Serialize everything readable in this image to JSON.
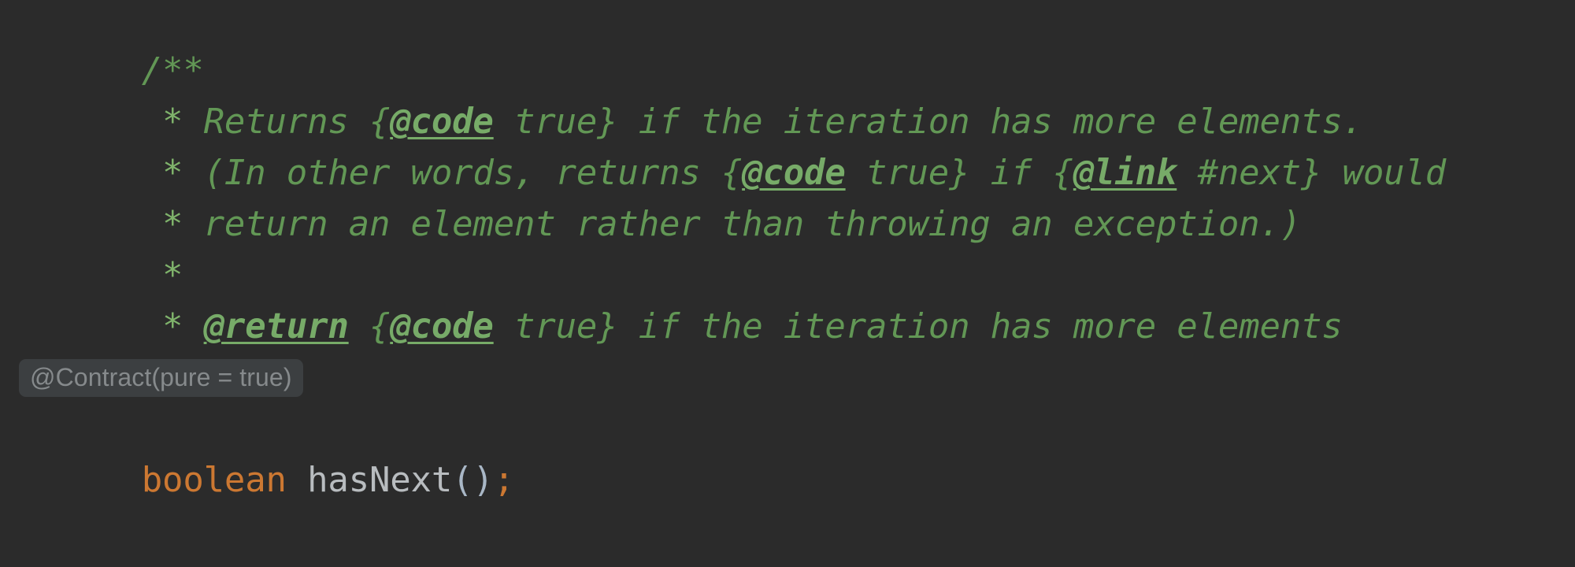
{
  "editor": {
    "theme": "Darcula",
    "language": "Java",
    "background_color": "#2b2b2b",
    "comment_color": "#629755",
    "tag_color": "#77ab68",
    "keyword_color": "#cc7832",
    "identifier_color": "#b8bcbf",
    "inlay_bg_color": "#3c3f41",
    "inlay_text_color": "#868a8c"
  },
  "javadoc": {
    "open": "/**",
    "close": " */",
    "lines": [
      {
        "star": " * ",
        "parts": [
          {
            "t": "Returns {",
            "tag": false
          },
          {
            "t": "@code",
            "tag": true
          },
          {
            "t": " true} if the iteration has more elements.",
            "tag": false
          }
        ]
      },
      {
        "star": " * ",
        "parts": [
          {
            "t": "(In other words, returns {",
            "tag": false
          },
          {
            "t": "@code",
            "tag": true
          },
          {
            "t": " true} if {",
            "tag": false
          },
          {
            "t": "@link",
            "tag": true
          },
          {
            "t": " #next} would",
            "tag": false
          }
        ]
      },
      {
        "star": " * ",
        "parts": [
          {
            "t": "return an element rather than throwing an exception.)",
            "tag": false
          }
        ]
      },
      {
        "star": " *",
        "parts": []
      },
      {
        "star": " * ",
        "parts": [
          {
            "t": "@return",
            "tag": true
          },
          {
            "t": " {",
            "tag": false
          },
          {
            "t": "@code",
            "tag": true
          },
          {
            "t": " true} if the iteration has more elements",
            "tag": false
          }
        ]
      }
    ]
  },
  "inlay": {
    "annotation_hint": "@Contract(pure = true)"
  },
  "signature": {
    "return_type": "boolean",
    "indent": "",
    "method_name": "hasNext",
    "parens": "()",
    "terminator": ";"
  }
}
